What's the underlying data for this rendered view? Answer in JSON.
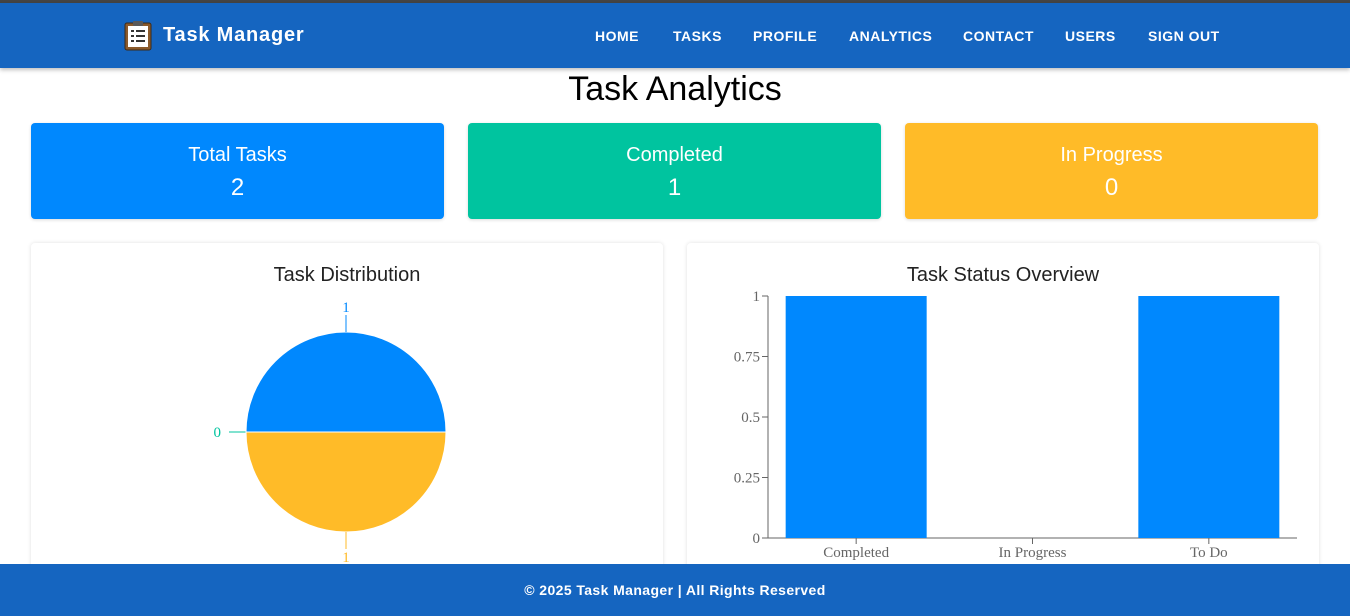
{
  "app": {
    "title": "Task Manager"
  },
  "nav": {
    "items": [
      {
        "label": "HOME"
      },
      {
        "label": "TASKS"
      },
      {
        "label": "PROFILE"
      },
      {
        "label": "ANALYTICS"
      },
      {
        "label": "CONTACT"
      },
      {
        "label": "USERS"
      },
      {
        "label": "SIGN OUT"
      }
    ]
  },
  "page": {
    "title": "Task Analytics"
  },
  "stats": [
    {
      "label": "Total Tasks",
      "value": "2",
      "color": "#0088fe"
    },
    {
      "label": "Completed",
      "value": "1",
      "color": "#00c49f"
    },
    {
      "label": "In Progress",
      "value": "0",
      "color": "#ffbb28"
    }
  ],
  "panels": {
    "distribution": {
      "title": "Task Distribution"
    },
    "status": {
      "title": "Task Status Overview"
    }
  },
  "chart_data": [
    {
      "type": "pie",
      "title": "Task Distribution",
      "slices": [
        {
          "value": 1,
          "label": "1",
          "color": "#0088fe"
        },
        {
          "value": 0,
          "label": "0",
          "color": "#00c49f"
        },
        {
          "value": 1,
          "label": "1",
          "color": "#ffbb28"
        }
      ]
    },
    {
      "type": "bar",
      "title": "Task Status Overview",
      "categories": [
        "Completed",
        "In Progress",
        "To Do"
      ],
      "values": [
        1,
        0,
        1
      ],
      "ylim": [
        0,
        1
      ],
      "yticks": [
        "0",
        "0.25",
        "0.5",
        "0.75",
        "1"
      ],
      "bar_color": "#0088fe"
    }
  ],
  "footer": {
    "text": "© 2025 Task Manager | All Rights Reserved"
  }
}
